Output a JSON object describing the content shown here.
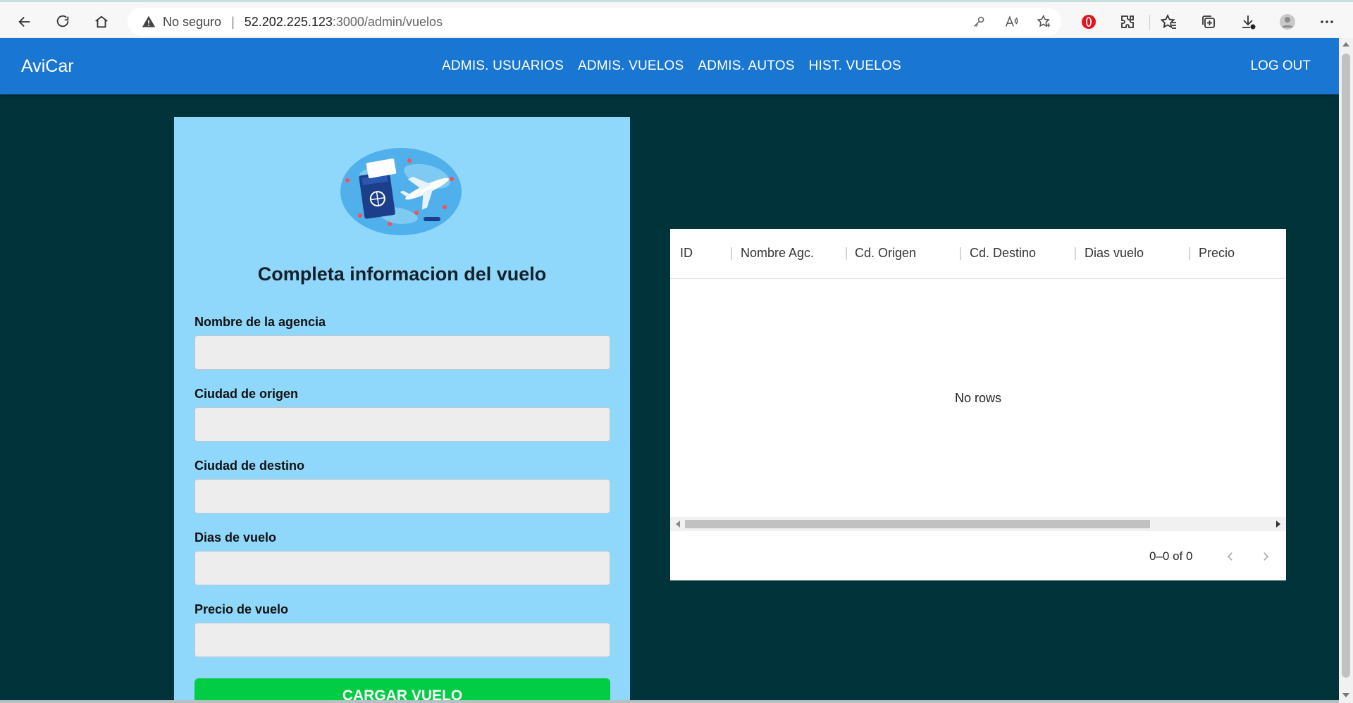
{
  "browser": {
    "security_text": "No seguro",
    "url_host": "52.202.225.123",
    "url_rest": ":3000/admin/vuelos"
  },
  "appbar": {
    "brand": "AviCar",
    "nav": [
      "ADMIS. USUARIOS",
      "ADMIS. VUELOS",
      "ADMIS. AUTOS",
      "HIST. VUELOS"
    ],
    "logout": "LOG OUT"
  },
  "form": {
    "title": "Completa informacion del vuelo",
    "fields": [
      {
        "label": "Nombre de la agencia",
        "value": ""
      },
      {
        "label": "Ciudad de origen",
        "value": ""
      },
      {
        "label": "Ciudad de destino",
        "value": ""
      },
      {
        "label": "Dias de vuelo",
        "value": ""
      },
      {
        "label": "Precio de vuelo",
        "value": ""
      }
    ],
    "submit": "CARGAR VUELO"
  },
  "grid": {
    "columns": [
      "ID",
      "Nombre Agc.",
      "Cd. Origen",
      "Cd. Destino",
      "Dias vuelo",
      "Precio"
    ],
    "empty_text": "No rows",
    "pagination": "0–0 of 0"
  },
  "colors": {
    "appbar": "#1976d2",
    "background": "#00343a",
    "form_panel": "#90d8fb",
    "submit_button": "#00cc44"
  }
}
